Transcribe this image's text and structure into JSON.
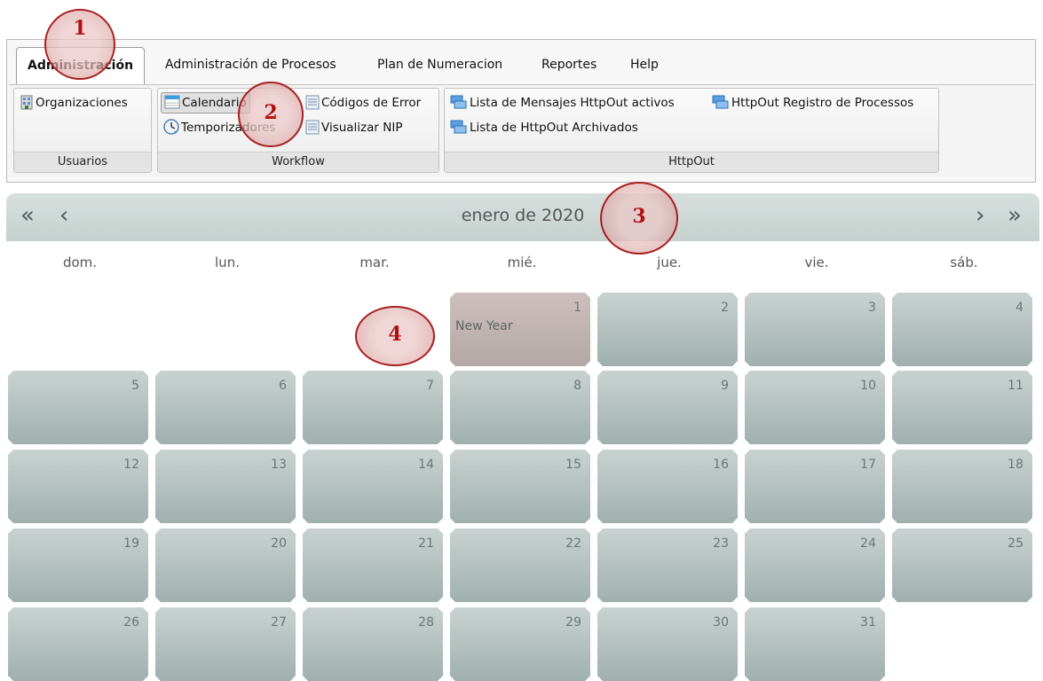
{
  "tabs": [
    {
      "label": "Administración",
      "active": true
    },
    {
      "label": "Administración de Procesos"
    },
    {
      "label": "Plan de Numeracion"
    },
    {
      "label": "Reportes"
    },
    {
      "label": "Help"
    }
  ],
  "groups": {
    "usuarios": {
      "title": "Usuarios",
      "items": [
        {
          "label": "Organizaciones",
          "icon": "building-icon"
        }
      ]
    },
    "workflow": {
      "title": "Workflow",
      "items": [
        {
          "label": "Calendario",
          "icon": "calendar-icon",
          "pressed": true
        },
        {
          "label": "Temporizadores",
          "icon": "clock-icon"
        },
        {
          "label": "Códigos de Error",
          "icon": "document-icon"
        },
        {
          "label": "Visualizar NIP",
          "icon": "document-icon"
        }
      ]
    },
    "httpout": {
      "title": "HttpOut",
      "items": [
        {
          "label": "Lista de Mensajes HttpOut activos",
          "icon": "messages-icon"
        },
        {
          "label": "HttpOut Registro de Processos",
          "icon": "messages-icon"
        },
        {
          "label": "Lista de HttpOut Archivados",
          "icon": "messages-icon"
        }
      ]
    }
  },
  "calendar": {
    "month_label": "enero de 2020",
    "nav": {
      "prev_year": "«",
      "prev": "‹",
      "next": "›",
      "next_year": "»"
    },
    "weekdays": [
      "dom.",
      "lun.",
      "mar.",
      "mié.",
      "jue.",
      "vie.",
      "sáb."
    ],
    "days": [
      "1",
      "2",
      "3",
      "4",
      "5",
      "6",
      "7",
      "8",
      "9",
      "10",
      "11",
      "12",
      "13",
      "14",
      "15",
      "16",
      "17",
      "18",
      "19",
      "20",
      "21",
      "22",
      "23",
      "24",
      "25",
      "26",
      "27",
      "28",
      "29",
      "30",
      "31"
    ],
    "events": {
      "new_year": "New Year"
    }
  },
  "markers": [
    "1",
    "2",
    "3",
    "4"
  ],
  "colors": {
    "cell": "#b6c3c1",
    "holiday": "#c3b6b4",
    "header": "#cdd7d5",
    "marker": "#b01010"
  }
}
